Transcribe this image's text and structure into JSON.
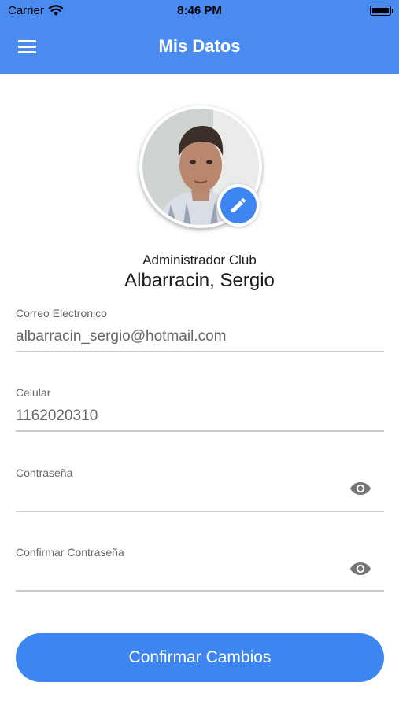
{
  "status_bar": {
    "carrier": "Carrier",
    "time": "8:46 PM"
  },
  "header": {
    "title": "Mis Datos",
    "background": "#4a8bf0",
    "menu_icon": "hamburger-menu-icon"
  },
  "profile": {
    "role": "Administrador Club",
    "name": "Albarracin, Sergio",
    "edit_icon": "pencil-icon"
  },
  "form": {
    "email": {
      "label": "Correo Electronico",
      "value": "albarracin_sergio@hotmail.com"
    },
    "phone": {
      "label": "Celular",
      "value": "1162020310"
    },
    "password": {
      "label": "Contraseña",
      "value": "",
      "icon": "eye-icon"
    },
    "confirm_password": {
      "label": "Confirmar Contraseña",
      "value": "",
      "icon": "eye-icon"
    }
  },
  "actions": {
    "confirm_label": "Confirmar Cambios",
    "accent": "#3d86f2"
  }
}
